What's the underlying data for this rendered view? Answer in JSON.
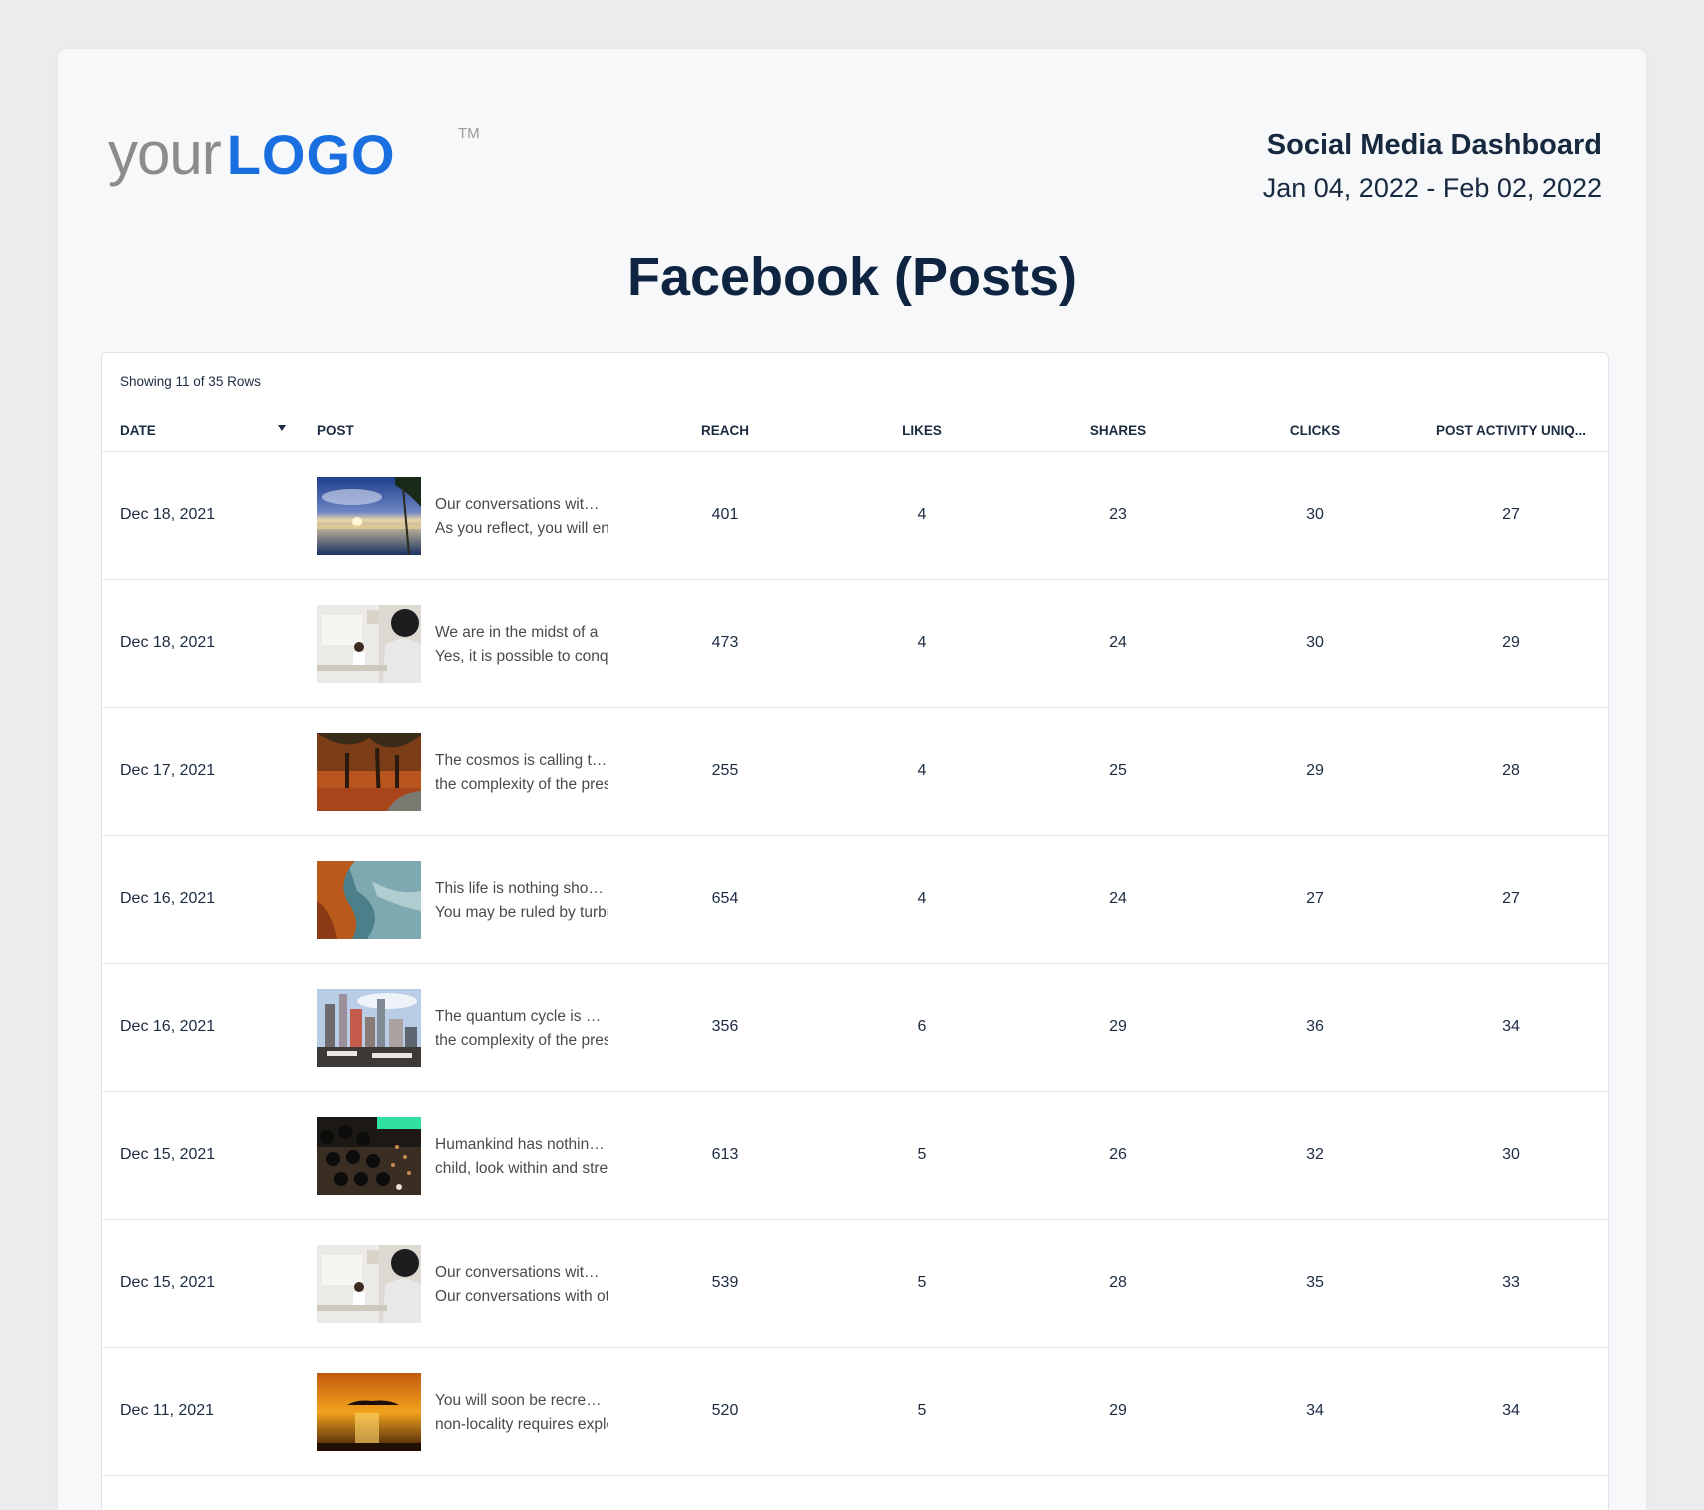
{
  "logo": {
    "your": "your",
    "logo": "LOGO",
    "tm": "TM"
  },
  "header": {
    "dashboard_title": "Social Media Dashboard",
    "date_range": "Jan 04, 2022 - Feb 02, 2022"
  },
  "page_title": "Facebook (Posts)",
  "table": {
    "showing": "Showing 11 of 35 Rows",
    "columns": [
      "DATE",
      "POST",
      "REACH",
      "LIKES",
      "SHARES",
      "CLICKS",
      "POST ACTIVITY UNIQ..."
    ],
    "rows": [
      {
        "date": "Dec 18, 2021",
        "thumb": "lake-sunset-palm",
        "line1": "Our conversations with other",
        "line2": "As you reflect, you will enter",
        "reach": "401",
        "likes": "4",
        "shares": "23",
        "clicks": "30",
        "unique": "27"
      },
      {
        "date": "Dec 18, 2021",
        "thumb": "office-workers",
        "line1": "We are in the midst of a",
        "line2": "Yes, it is possible to conquer",
        "reach": "473",
        "likes": "4",
        "shares": "24",
        "clicks": "30",
        "unique": "29"
      },
      {
        "date": "Dec 17, 2021",
        "thumb": "autumn-trees",
        "line1": "The cosmos is calling to you",
        "line2": "the complexity of the present",
        "reach": "255",
        "likes": "4",
        "shares": "25",
        "clicks": "29",
        "unique": "28"
      },
      {
        "date": "Dec 16, 2021",
        "thumb": "rocky-coast",
        "line1": "This life is nothing short of",
        "line2": "You may be ruled by turbulence",
        "reach": "654",
        "likes": "4",
        "shares": "24",
        "clicks": "27",
        "unique": "27"
      },
      {
        "date": "Dec 16, 2021",
        "thumb": "city-skyline",
        "line1": "The quantum cycle is calling",
        "line2": "the complexity of the present",
        "reach": "356",
        "likes": "6",
        "shares": "29",
        "clicks": "36",
        "unique": "34"
      },
      {
        "date": "Dec 15, 2021",
        "thumb": "audio-mixer",
        "line1": "Humankind has nothing to lose",
        "line2": "child, look within and strengthen",
        "reach": "613",
        "likes": "5",
        "shares": "26",
        "clicks": "32",
        "unique": "30"
      },
      {
        "date": "Dec 15, 2021",
        "thumb": "office-workers",
        "line1": "Our conversations with other",
        "line2": "Our conversations with other",
        "reach": "539",
        "likes": "5",
        "shares": "28",
        "clicks": "35",
        "unique": "33"
      },
      {
        "date": "Dec 11, 2021",
        "thumb": "sunset-sea",
        "line1": "You will soon be recreated",
        "line2": "non-locality requires exploration",
        "reach": "520",
        "likes": "5",
        "shares": "29",
        "clicks": "34",
        "unique": "34"
      }
    ]
  },
  "colors": {
    "brand_blue": "#1a6fe0",
    "navy_text": "#0e2440",
    "page_bg": "#ebecee"
  }
}
